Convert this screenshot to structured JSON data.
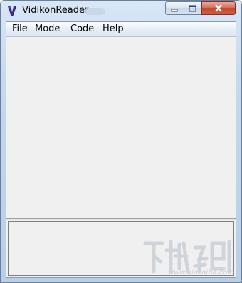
{
  "window": {
    "title": "VidikonReader"
  },
  "menubar": {
    "items": [
      {
        "label": "File"
      },
      {
        "label": "Mode"
      },
      {
        "label": "Code"
      },
      {
        "label": "Help"
      }
    ]
  },
  "watermark": {
    "url": "www.xiazaiba.com"
  },
  "colors": {
    "close_button": "#c4452c",
    "app_icon": "#3a2a8a",
    "content_bg": "#f0f0f0"
  }
}
